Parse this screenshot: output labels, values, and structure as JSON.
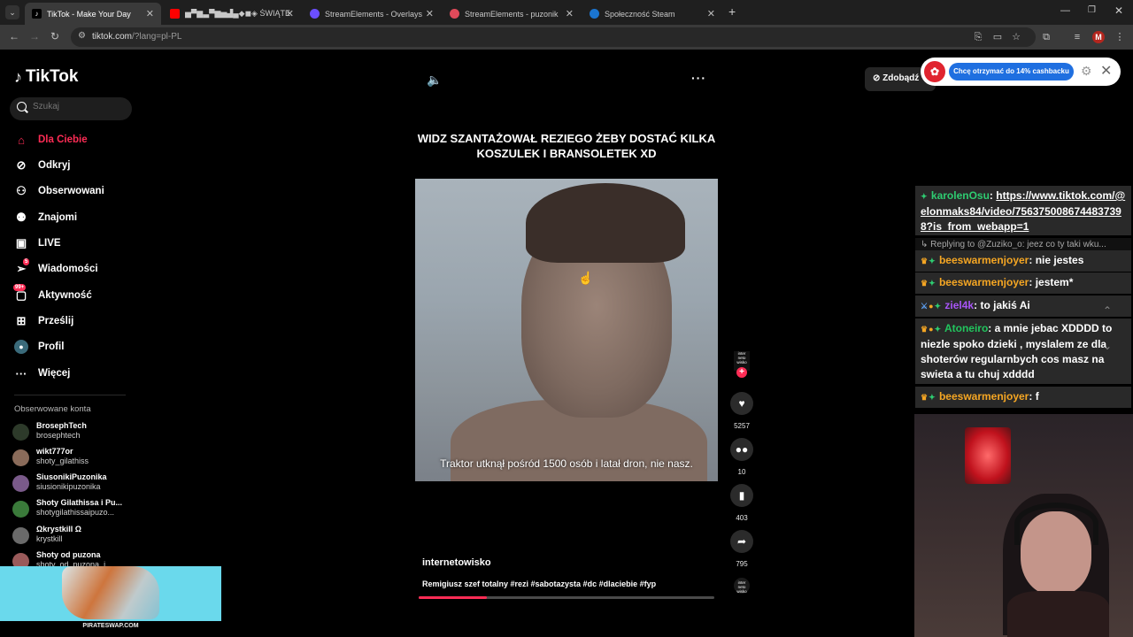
{
  "browser": {
    "tabs": [
      {
        "title": "TikTok - Make Your Day",
        "active": true,
        "color": "#000000"
      },
      {
        "title": "▅▀▆▃▀▆▅▟▄◆◼◈ ŚWIĄTE",
        "active": false,
        "color": "#ff0000"
      },
      {
        "title": "StreamElements - Overlays",
        "active": false,
        "color": "#6b4eff"
      },
      {
        "title": "StreamElements - puzonik",
        "active": false,
        "color": "#e04a5a"
      },
      {
        "title": "Społeczność Steam",
        "active": false,
        "color": "#1b75d0"
      }
    ],
    "url_domain": "tiktok.com",
    "url_path": "/?lang=pl-PL",
    "profile_initial": "M"
  },
  "sidebar": {
    "logo": "TikTok",
    "search_placeholder": "Szukaj",
    "nav": [
      {
        "label": "Dla Ciebie",
        "icon": "home-icon",
        "active": true
      },
      {
        "label": "Odkryj",
        "icon": "compass-icon"
      },
      {
        "label": "Obserwowani",
        "icon": "following-icon"
      },
      {
        "label": "Znajomi",
        "icon": "friends-icon"
      },
      {
        "label": "LIVE",
        "icon": "live-icon"
      },
      {
        "label": "Wiadomości",
        "icon": "messages-icon",
        "badge": "5"
      },
      {
        "label": "Aktywność",
        "icon": "activity-icon",
        "badge": "99+"
      },
      {
        "label": "Prześlij",
        "icon": "upload-icon"
      },
      {
        "label": "Profil",
        "icon": "profile-icon"
      },
      {
        "label": "Więcej",
        "icon": "more-icon"
      }
    ],
    "followed_title": "Obserwowane konta",
    "accounts": [
      {
        "name": "BrosephTech",
        "handle": "brosephtech",
        "color": "#2d3a2a"
      },
      {
        "name": "wikt777or",
        "handle": "shoty_gilathiss",
        "color": "#8a6b5a"
      },
      {
        "name": "SiusonikiPuzonika",
        "handle": "siusionikipuzonika",
        "color": "#7a5a8a"
      },
      {
        "name": "Shoty Gilathissa i Pu...",
        "handle": "shotygilathissaipuzo...",
        "color": "#3a7a3a"
      },
      {
        "name": "Ωkrystkill Ω",
        "handle": "krystkill",
        "color": "#6a6a6a"
      },
      {
        "name": "Shoty od puzona",
        "handle": "shoty_od_puzona_i...",
        "color": "#9a5a5a"
      }
    ]
  },
  "video": {
    "title": "WIDZ SZANTAŻOWAŁ REZIEGO ŻEBY DOSTAĆ KILKA KOSZULEK I BRANSOLETEK XD",
    "subtitle": "Traktor utknął pośród 1500 osób i latał dron, nie nasz.",
    "author": "internetowisko",
    "description": "Remigiusz szef totalny #rezi #sabotazysta #dc #dlaciebie #fyp",
    "creator_avatar_text": "inter neto wisko",
    "likes": "5257",
    "comments": "10",
    "saves": "403",
    "shares": "795",
    "progress": 0.23
  },
  "topright": {
    "coins_label": "Zdobądź",
    "cashback_label": "Chcę otrzymać do 14% cashbacku"
  },
  "chat": {
    "messages": [
      {
        "user": "karolenOsu",
        "color": "#2ecc71",
        "text": "https://www.tiktok.com/@elonmaks84/video/7563750086744837398?is_from_webapp=1",
        "link": true
      },
      {
        "reply": "Replying to @Zuziko_o: jeez co ty taki wku..."
      },
      {
        "user": "beeswarmenjoyer",
        "color": "#f5a623",
        "text": "nie jestes"
      },
      {
        "user": "beeswarmenjoyer",
        "color": "#f5a623",
        "text": "jestem*"
      },
      {
        "user": "ziel4k",
        "color": "#a855f7",
        "text": "to jakiś Ai"
      },
      {
        "user": "Atoneiro",
        "color": "#22c55e",
        "text": "a mnie jebac XDDDD to niezle spoko dzieki , myslalem ze dla shoterów regularnbych cos masz na swieta a tu chuj xdddd"
      },
      {
        "user": "beeswarmenjoyer",
        "color": "#f5a623",
        "text": "f"
      }
    ]
  },
  "ad": {
    "text": "PIRATESWAP.COM"
  }
}
